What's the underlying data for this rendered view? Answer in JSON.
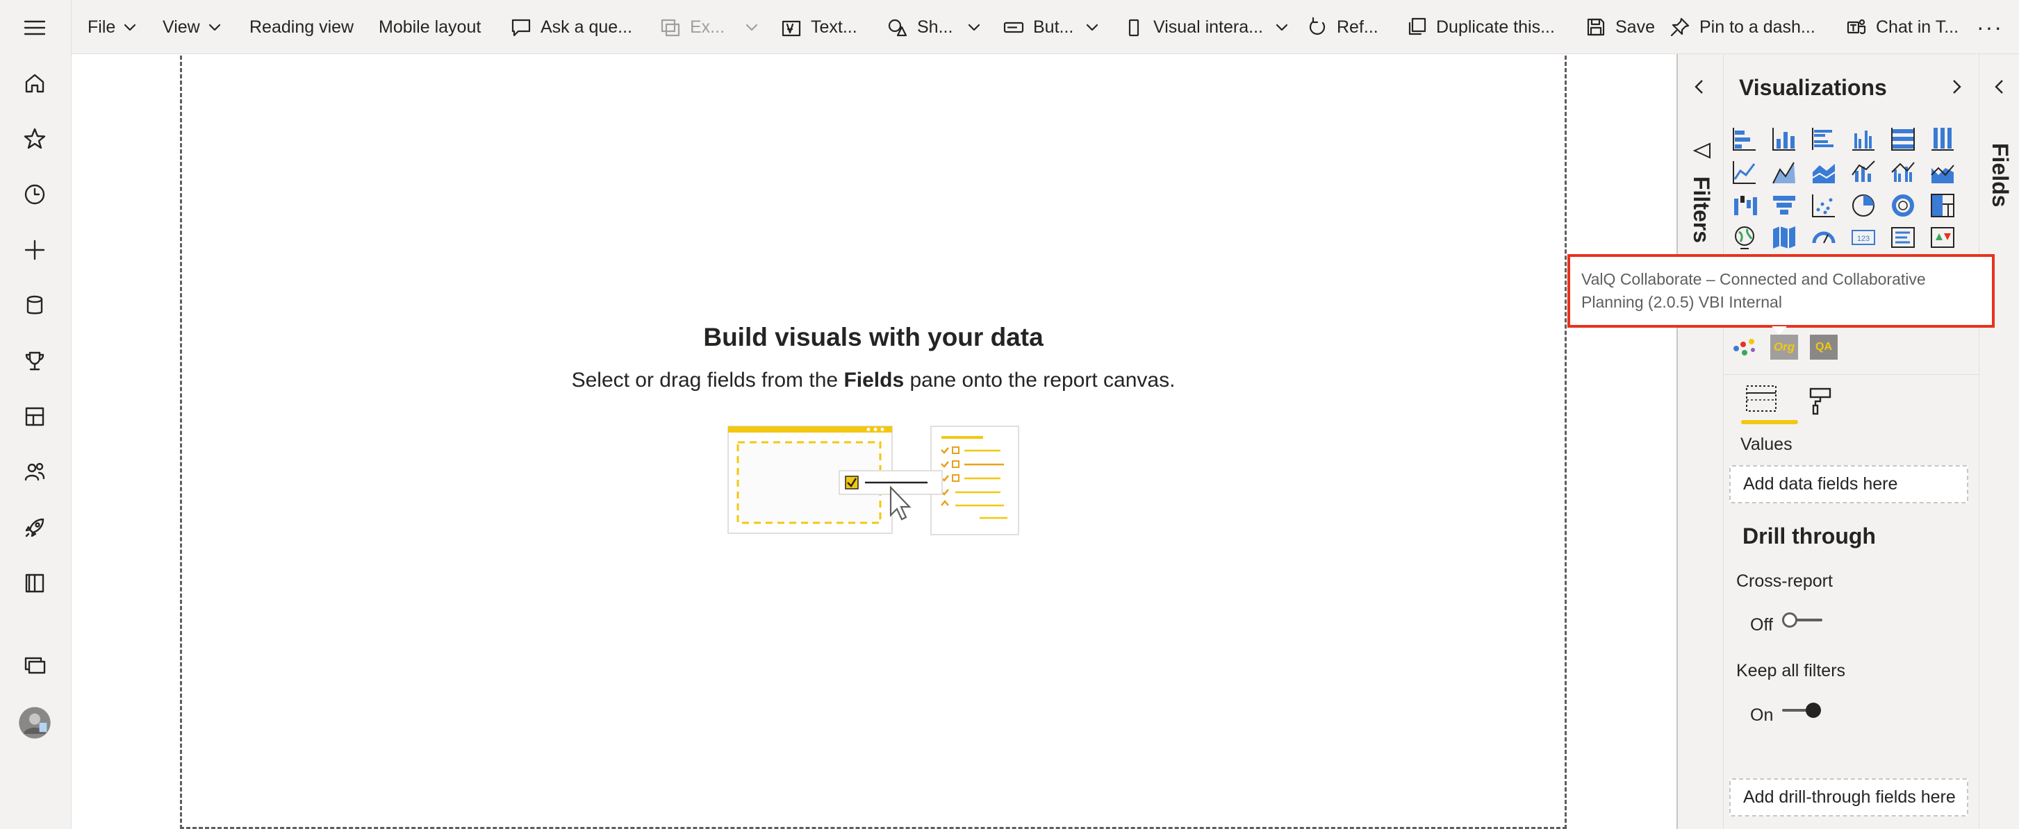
{
  "toolbar": {
    "file": "File",
    "view": "View",
    "reading_view": "Reading view",
    "mobile_layout": "Mobile layout",
    "ask_question": "Ask a que...",
    "export": "Ex...",
    "textbox": "Text...",
    "shapes": "Sh...",
    "buttons": "But...",
    "visual_interactions": "Visual intera...",
    "refresh": "Ref...",
    "duplicate": "Duplicate this...",
    "save": "Save",
    "pin": "Pin to a dash...",
    "chat": "Chat in T...",
    "more": "···"
  },
  "canvas": {
    "title": "Build visuals with your data",
    "subtitle_before": "Select or drag fields from the ",
    "subtitle_bold": "Fields",
    "subtitle_after": " pane onto the report canvas."
  },
  "filters": {
    "label": "Filters"
  },
  "visualizations": {
    "title": "Visualizations",
    "values_label": "Values",
    "values_well": "Add data fields here",
    "drill_title": "Drill through",
    "cross_report_label": "Cross-report",
    "cross_report_state": "Off",
    "keep_filters_label": "Keep all filters",
    "keep_filters_state": "On",
    "drill_well": "Add drill-through fields here",
    "custom_visuals": [
      "Org",
      "QA"
    ]
  },
  "fields": {
    "label": "Fields"
  },
  "tooltip": {
    "line1": "ValQ Collaborate – Connected and Collaborative",
    "line2": "Planning (2.0.5) VBI Internal"
  },
  "colors": {
    "accent_yellow": "#f2c811",
    "viz_blue": "#3a7bd5",
    "tooltip_border": "#e8321e"
  }
}
